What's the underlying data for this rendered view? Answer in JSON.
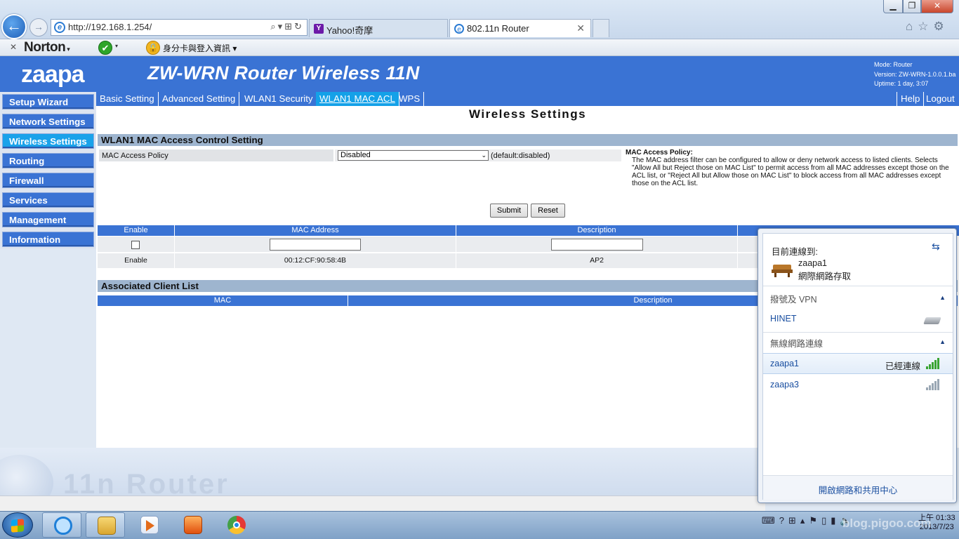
{
  "browser": {
    "url": "http://192.168.1.254/",
    "tabs": [
      {
        "label": "Yahoo!奇摩",
        "icon": "yahoo-icon"
      },
      {
        "label": "802.11n Router",
        "icon": "ie-icon"
      }
    ],
    "toolbar": {
      "norton_label": "Norton",
      "id_label": "身分卡與登入資訊"
    }
  },
  "router": {
    "logo_text": "zaapa",
    "product_title": "ZW-WRN Router Wireless 11N",
    "info": {
      "mode": "Mode: Router",
      "version": "Version: ZW-WRN-1.0.0.1.ba",
      "uptime": "Uptime: 1 day, 3:07"
    },
    "sidebar": [
      {
        "label": "Setup Wizard"
      },
      {
        "label": "Network Settings"
      },
      {
        "label": "Wireless Settings",
        "active": true
      },
      {
        "label": "Routing"
      },
      {
        "label": "Firewall"
      },
      {
        "label": "Services"
      },
      {
        "label": "Management"
      },
      {
        "label": "Information"
      }
    ],
    "tabs": [
      {
        "label": "Basic Setting"
      },
      {
        "label": "Advanced Setting"
      },
      {
        "label": "WLAN1 Security"
      },
      {
        "label": "WLAN1 MAC ACL",
        "active": true
      },
      {
        "label": "WPS"
      }
    ],
    "right_links": {
      "help": "Help",
      "logout": "Logout"
    },
    "page_title": "Wireless Settings",
    "acl_section": {
      "title": "WLAN1 MAC Access Control Setting",
      "policy_label": "MAC Access Policy",
      "policy_value": "Disabled",
      "policy_default": "(default:disabled)",
      "submit": "Submit",
      "reset": "Reset"
    },
    "help": {
      "title": "MAC Access Policy:",
      "body": "The MAC address filter can be configured to allow or deny network access to listed clients. Selects \"Allow All but Reject those on MAC List\" to permit access from all MAC addresses except those on the ACL list, or \"Reject All but Allow those on MAC List\" to block access from all MAC addresses except those on the ACL list."
    },
    "acl_table": {
      "columns": [
        "Enable",
        "MAC Address",
        "Description"
      ],
      "rows": [
        {
          "enable": "Enable",
          "mac": "00:12:CF:90:58:4B",
          "desc": "AP2"
        }
      ]
    },
    "clients_section": {
      "title": "Associated Client List",
      "columns": [
        "MAC",
        "Description"
      ]
    },
    "watermark": "11n Router"
  },
  "network_flyout": {
    "connected_to": "目前連線到:",
    "current_network": "zaapa1",
    "current_status": "網際網路存取",
    "dialup_header": "撥號及 VPN",
    "dialup_item": "HINET",
    "wireless_header": "無線網路連線",
    "networks": [
      {
        "name": "zaapa1",
        "status": "已經連線",
        "connected": true
      },
      {
        "name": "zaapa3",
        "status": "",
        "connected": false
      }
    ],
    "footer_link": "開啟網路和共用中心"
  },
  "taskbar": {
    "clock_time": "上午 01:33",
    "clock_date": "2013/7/23",
    "watermark_text": "blog.pigoo.com"
  }
}
